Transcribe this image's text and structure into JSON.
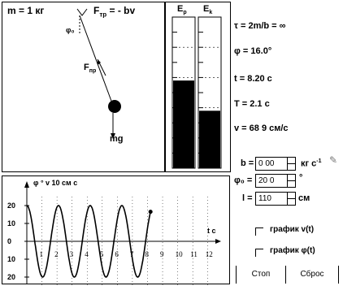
{
  "simulation": {
    "mass_label": "m = 1 кг",
    "friction_label": "F",
    "friction_sub": "тр",
    "friction_rhs": "= - bv",
    "phi0_label": "φ₀",
    "tension_label": "F",
    "tension_sub": "пр",
    "gravity_label": "mg"
  },
  "energy": {
    "ep_label": "E",
    "ep_sub": "p",
    "ek_label": "E",
    "ek_sub": "k",
    "ep_fraction": 0.58,
    "ek_fraction": 0.38
  },
  "readouts": {
    "tau": "τ = 2m/b = ∞",
    "phi": "φ = 16.0°",
    "time": "t = 8.20 с",
    "period": "T = 2.1 с",
    "velocity": "v = 68 9 см/с"
  },
  "controls": {
    "b_label": "b =",
    "b_value": "0 00",
    "b_unit": "кг  с",
    "b_unit_sup": "-1",
    "phi0_label": "φ₀ =",
    "phi0_value": "20 0",
    "phi0_unit": "°",
    "l_label": "l =",
    "l_value": "110",
    "l_unit": "см",
    "graph_v_label": "график v(t)",
    "graph_phi_label": "график φ(t)",
    "stop_label": "Стоп",
    "reset_label": "Сброс"
  },
  "graph": {
    "header": "φ °  v 10 см  с",
    "t_axis_label": "t  с",
    "y_ticks": [
      "20",
      "10",
      "0",
      "10",
      "20"
    ],
    "x_ticks": [
      "1",
      "2",
      "3",
      "4",
      "5",
      "6",
      "7",
      "8",
      "9",
      "10",
      "11",
      "12"
    ],
    "amplitude_deg": 20,
    "period_s": 2.1,
    "t_end_s": 8.2,
    "t_max_s": 12.5,
    "y_max": 25
  }
}
